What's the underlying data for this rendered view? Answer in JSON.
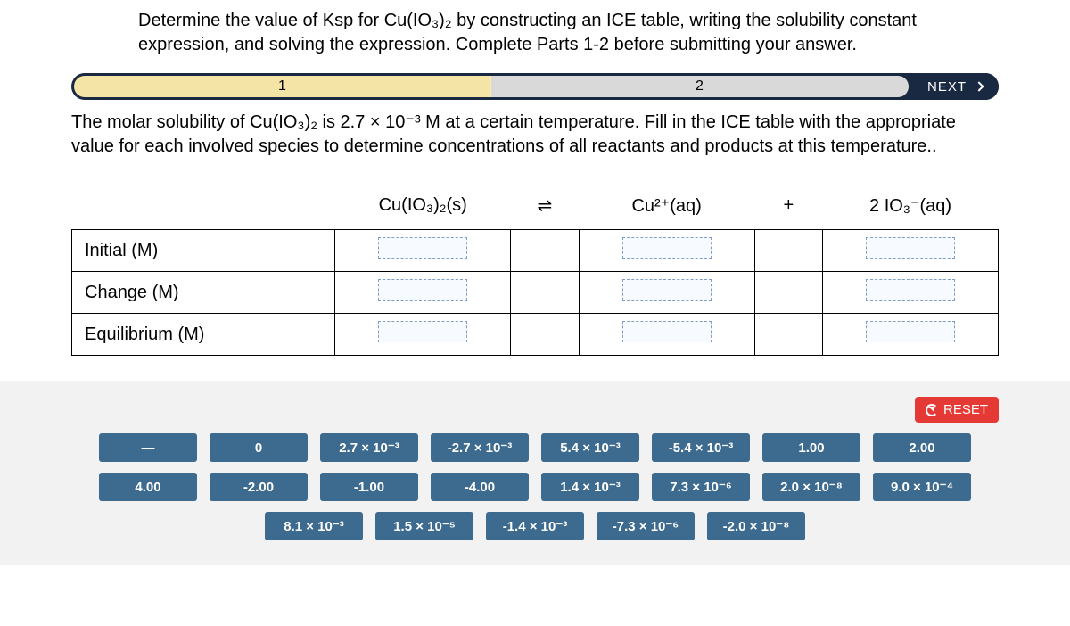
{
  "instructions": "Determine the value of Ksp for Cu(IO₃)₂ by constructing an ICE table, writing the solubility constant expression, and solving the expression. Complete Parts 1-2 before submitting your answer.",
  "steps": {
    "one": "1",
    "two": "2"
  },
  "next_label": "NEXT",
  "sub_instructions": "The molar solubility of Cu(IO₃)₂ is 2.7 × 10⁻³ M at a certain temperature. Fill in the ICE table with the appropriate value for each involved species to determine concentrations of all reactants and products at this temperature..",
  "ice": {
    "headers": {
      "blank": "",
      "col1": "Cu(IO₃)₂(s)",
      "eq": "⇌",
      "col2": "Cu²⁺(aq)",
      "plus": "+",
      "col3": "2 IO₃⁻(aq)"
    },
    "rows": {
      "initial": "Initial (M)",
      "change": "Change (M)",
      "equilibrium": "Equilibrium (M)"
    }
  },
  "reset_label": "RESET",
  "tiles": {
    "r1": [
      "—",
      "0",
      "2.7 × 10⁻³",
      "-2.7 × 10⁻³",
      "5.4 × 10⁻³",
      "-5.4 × 10⁻³",
      "1.00",
      "2.00"
    ],
    "r2": [
      "4.00",
      "-2.00",
      "-1.00",
      "-4.00",
      "1.4 × 10⁻³",
      "7.3 × 10⁻⁶",
      "2.0 × 10⁻⁸",
      "9.0 × 10⁻⁴"
    ],
    "r3": [
      "8.1 × 10⁻³",
      "1.5 × 10⁻⁵",
      "-1.4 × 10⁻³",
      "-7.3 × 10⁻⁶",
      "-2.0 × 10⁻⁸"
    ]
  }
}
